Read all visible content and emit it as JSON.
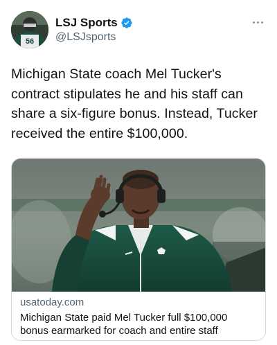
{
  "account": {
    "display_name": "LSJ Sports",
    "handle": "@LSJsports",
    "verified": true,
    "avatar_jersey_number": "56"
  },
  "tweet": {
    "text": "Michigan State coach Mel Tucker's contract stipulates he and his staff can share a six-figure bonus. Instead, Tucker received the entire $100,000."
  },
  "card": {
    "domain": "usatoday.com",
    "title": "Michigan State paid Mel Tucker full $100,000 bonus earmarked for coach and entire staff"
  },
  "icons": {
    "verified": "verified-badge-icon",
    "more": "more-options-icon"
  },
  "colors": {
    "verified_blue": "#1d9bf0",
    "secondary_text": "#536471",
    "card_border": "#cfd9de",
    "spartan_green": "#18453b"
  }
}
